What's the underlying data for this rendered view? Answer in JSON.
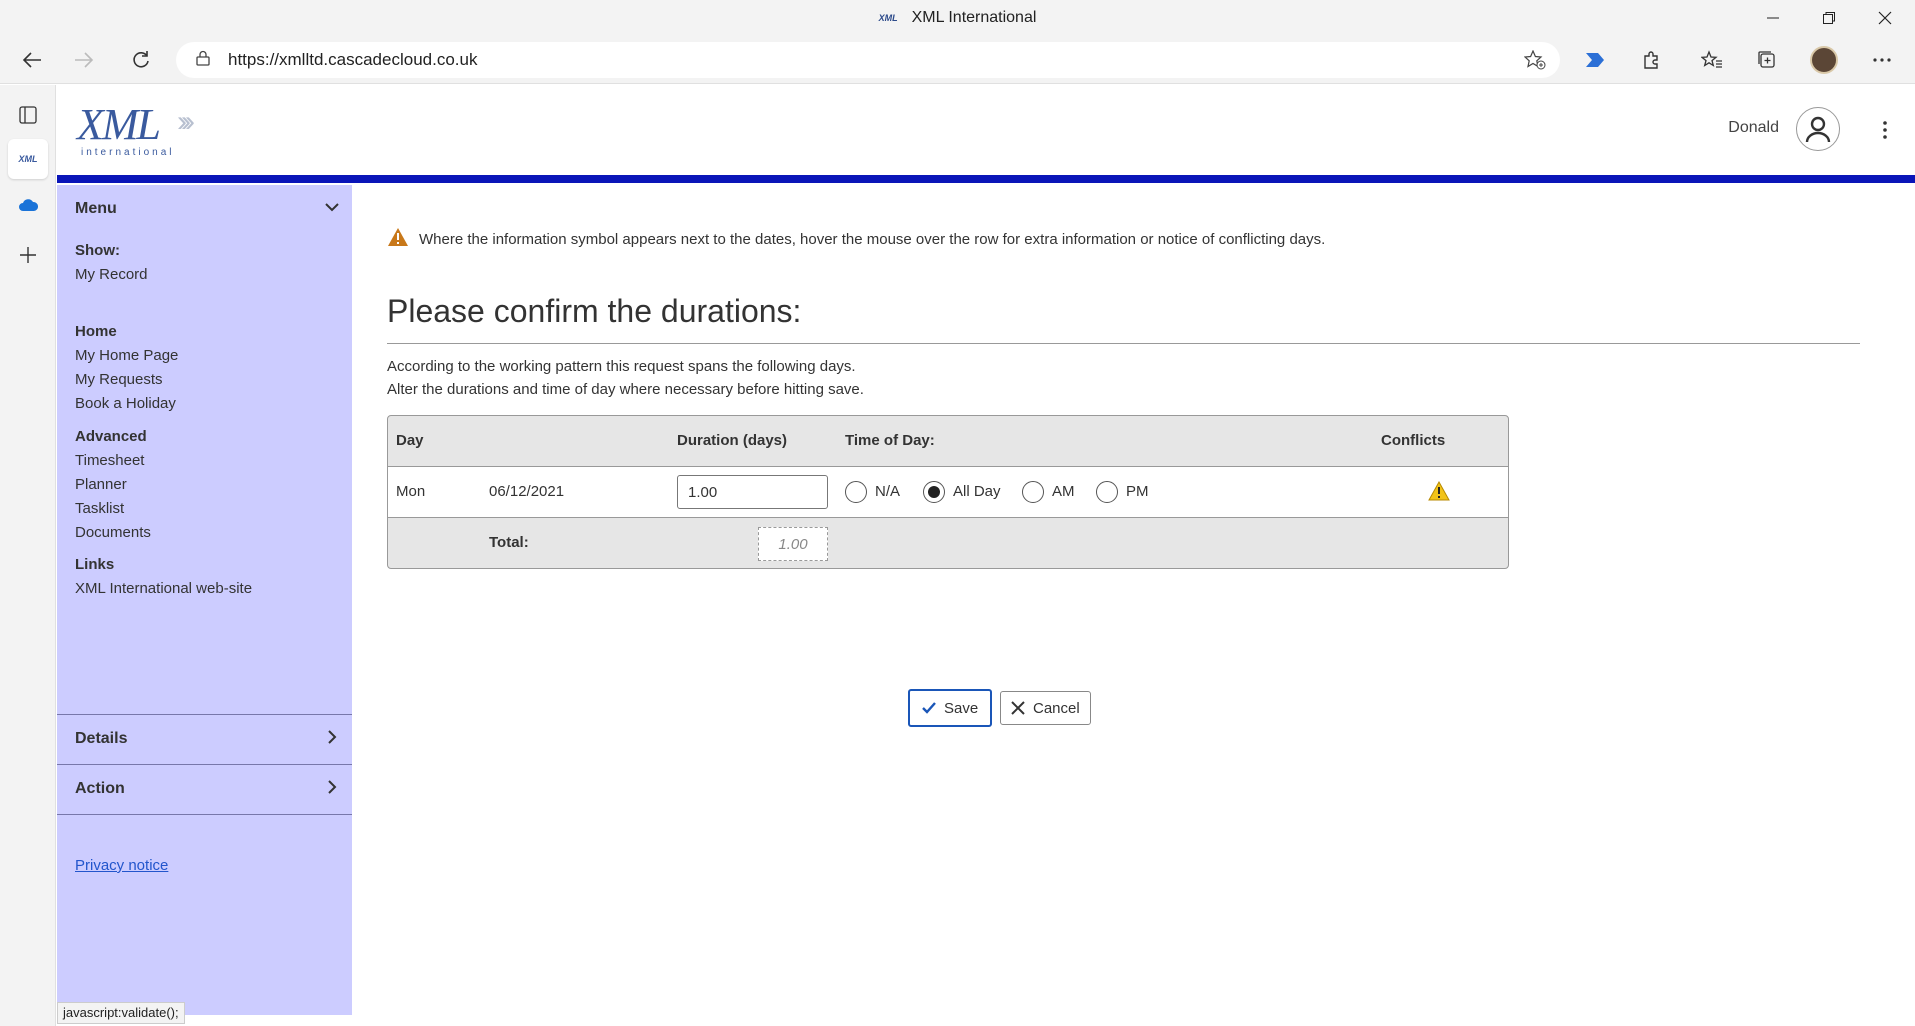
{
  "window": {
    "title": "XML International",
    "favicon_text": "XML"
  },
  "browser": {
    "url": "https://xmlltd.cascadecloud.co.uk",
    "status_text": "javascript:validate();"
  },
  "header": {
    "logo_text": "XML",
    "logo_sub": "international",
    "user_name": "Donald"
  },
  "sidebar": {
    "menu_label": "Menu",
    "sections": [
      {
        "title": "Show:",
        "items": [
          "My Record"
        ]
      },
      {
        "title": "Home",
        "items": [
          "My Home Page",
          "My Requests",
          "Book a Holiday"
        ]
      },
      {
        "title": "Advanced",
        "items": [
          "Timesheet",
          "Planner",
          "Tasklist",
          "Documents"
        ]
      },
      {
        "title": "Links",
        "items": [
          "XML International web-site"
        ]
      }
    ],
    "details_label": "Details",
    "action_label": "Action",
    "privacy_label": "Privacy notice"
  },
  "content": {
    "notice": "Where the information symbol appears next to the dates, hover the mouse over the row for extra information or notice of conflicting days.",
    "heading": "Please confirm the durations:",
    "desc_line1": "According to the working pattern this request spans the following days.",
    "desc_line2": "Alter the durations and time of day where necessary before hitting save.",
    "table": {
      "headers": {
        "day": "Day",
        "duration": "Duration (days)",
        "time_of_day": "Time of Day:",
        "conflicts": "Conflicts"
      },
      "rows": [
        {
          "day": "Mon",
          "date": "06/12/2021",
          "duration": "1.00",
          "time_options": [
            "N/A",
            "All Day",
            "AM",
            "PM"
          ],
          "selected": "All Day"
        }
      ],
      "total_label": "Total:",
      "total_value": "1.00"
    },
    "save_label": "Save",
    "cancel_label": "Cancel"
  },
  "colors": {
    "accent_bar": "#0a15b8",
    "sidebar_bg": "#ccccff",
    "save_border": "#1a56b8",
    "warning": "#d4a017"
  }
}
